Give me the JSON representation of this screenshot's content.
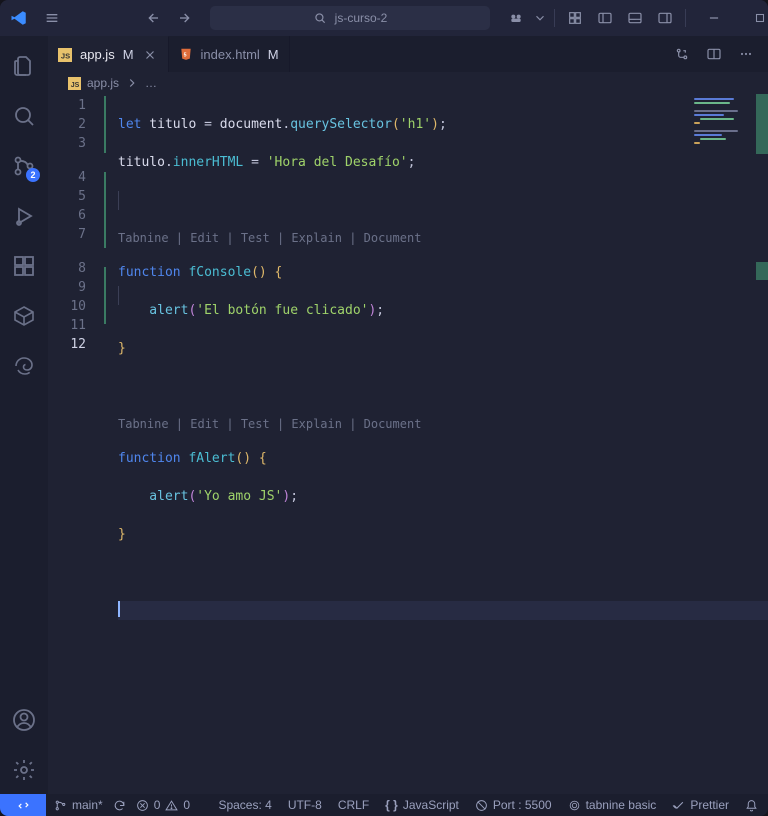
{
  "title": "js-curso-2",
  "tabs": [
    {
      "name": "app.js",
      "modified": "M",
      "active": true,
      "icon": "js"
    },
    {
      "name": "index.html",
      "modified": "M",
      "active": false,
      "icon": "html"
    }
  ],
  "breadcrumb": {
    "icon": "js",
    "file": "app.js",
    "rest": "…"
  },
  "scm_badge": "2",
  "codelens": "Tabnine | Edit | Test | Explain | Document",
  "code": {
    "l1_a": "let",
    "l1_b": " titulo ",
    "l1_c": "=",
    "l1_d": " document",
    "l1_dot1": ".",
    "l1_e": "querySelector",
    "l1_f": "(",
    "l1_g": "'h1'",
    "l1_h": ")",
    "l1_i": ";",
    "l2_a": "titulo",
    "l2_dot": ".",
    "l2_b": "innerHTML",
    "l2_c": " = ",
    "l2_d": "'Hora del Desafío'",
    "l2_e": ";",
    "l4_a": "function",
    "l4_b": " fConsole",
    "l4_c": "()",
    "l4_d": " {",
    "l5_a": "    alert",
    "l5_b": "(",
    "l5_c": "'El botón fue clicado'",
    "l5_d": ")",
    "l5_e": ";",
    "l6_a": "}",
    "l8_a": "function",
    "l8_b": " fAlert",
    "l8_c": "()",
    "l8_d": " {",
    "l9_a": "    alert",
    "l9_b": "(",
    "l9_c": "'Yo amo JS'",
    "l9_d": ")",
    "l9_e": ";",
    "l10_a": "}"
  },
  "line_numbers": [
    "1",
    "2",
    "3",
    "4",
    "5",
    "6",
    "7",
    "8",
    "9",
    "10",
    "11",
    "12"
  ],
  "current_line": 12,
  "status": {
    "branch": "main*",
    "sync_icon": true,
    "errors": "0",
    "warnings": "0",
    "spaces": "Spaces: 4",
    "encoding": "UTF-8",
    "eol": "CRLF",
    "lang": "JavaScript",
    "port": "Port : 5500",
    "tabnine": "tabnine basic",
    "prettier": "Prettier"
  }
}
